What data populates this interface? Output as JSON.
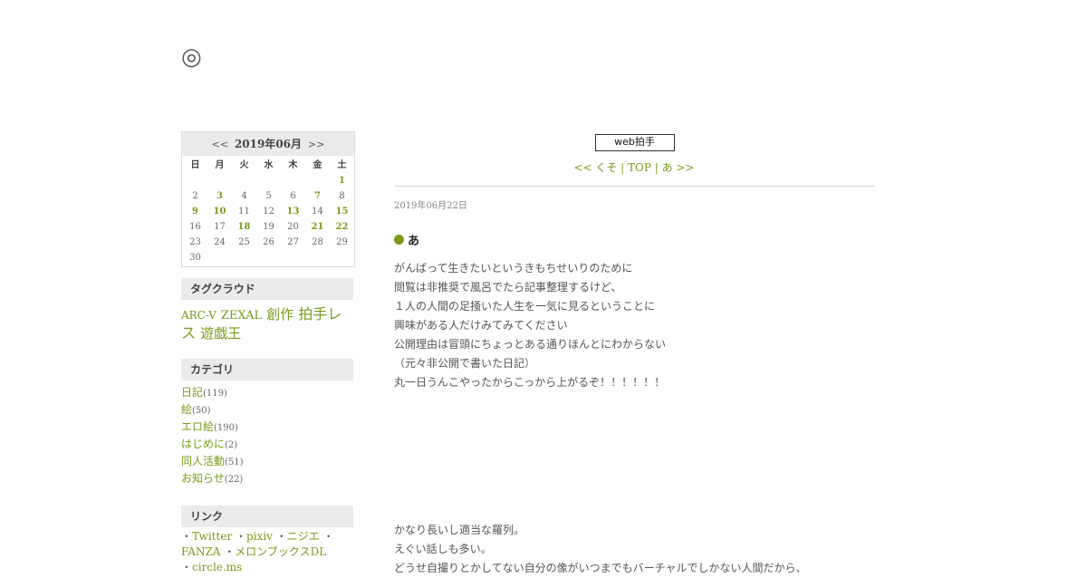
{
  "site": {
    "title": "◎"
  },
  "calendar": {
    "prev": "<<",
    "next": ">>",
    "month": "2019年06月",
    "dow": [
      "日",
      "月",
      "火",
      "水",
      "木",
      "金",
      "土"
    ],
    "days": [
      "",
      "",
      "",
      "",
      "",
      "",
      "1",
      "2",
      "3",
      "4",
      "5",
      "6",
      "7",
      "8",
      "9",
      "10",
      "11",
      "12",
      "13",
      "14",
      "15",
      "16",
      "17",
      "18",
      "19",
      "20",
      "21",
      "22",
      "23",
      "24",
      "25",
      "26",
      "27",
      "28",
      "29",
      "30",
      "",
      "",
      "",
      "",
      "",
      ""
    ],
    "linked_days": [
      "1",
      "3",
      "7",
      "9",
      "10",
      "13",
      "15",
      "18",
      "21",
      "22"
    ]
  },
  "tagcloud": {
    "heading": "タグクラウド",
    "tags": [
      {
        "label": "ARC-V",
        "size": "s"
      },
      {
        "label": "ZEXAL",
        "size": "m"
      },
      {
        "label": "創作",
        "size": "l"
      },
      {
        "label": "拍手レス",
        "size": "xl"
      },
      {
        "label": "遊戯王",
        "size": "l"
      }
    ]
  },
  "categories": {
    "heading": "カテゴリ",
    "items": [
      {
        "label": "日記",
        "count": "(119)"
      },
      {
        "label": "絵",
        "count": "(50)"
      },
      {
        "label": "エロ絵",
        "count": "(190)"
      },
      {
        "label": "はじめに",
        "count": "(2)"
      },
      {
        "label": "同人活動",
        "count": "(51)"
      },
      {
        "label": "お知らせ",
        "count": "(22)"
      }
    ]
  },
  "links": {
    "heading": "リンク",
    "items": [
      "Twitter",
      "pixiv",
      "ニジエ",
      "FANZA",
      "メロンブックスDL",
      "circle.ms"
    ]
  },
  "main": {
    "clap_label": "web拍手",
    "pager": {
      "prev": "<< くそ",
      "sep": " | ",
      "top": "TOP",
      "next": "あ >>"
    },
    "post": {
      "date": "2019年06月22日",
      "title": "あ",
      "body": [
        "がんばって生きたいというきもちせいりのために",
        "閲覧は非推奨で風呂でたら記事整理するけど、",
        "１人の人間の足掻いた人生を一気に見るということに",
        "興味がある人だけみてみてください",
        "公開理由は冒頭にちょっとある通りほんとにわからない",
        "（元々非公開で書いた日記）",
        "丸一日うんこやったからこっから上がるぞ！！！！！！"
      ],
      "body2": [
        "かなり長いし適当な羅列。",
        "えぐい話しも多い。",
        "どうせ自撮りとかしてない自分の像がいつまでもバーチャルでしかない人間だから、"
      ]
    }
  },
  "colors": {
    "link": "#7a9a1a",
    "panel": "#ebebea"
  }
}
